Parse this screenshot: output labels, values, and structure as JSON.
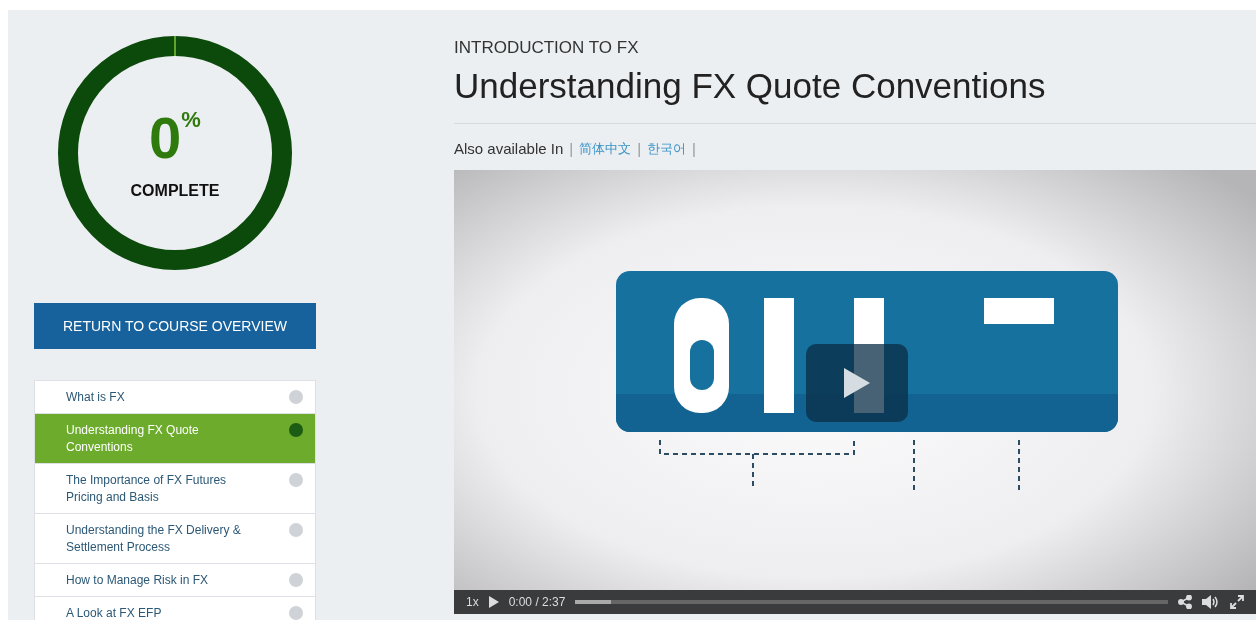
{
  "progress": {
    "value": "0",
    "unit": "%",
    "label": "COMPLETE"
  },
  "return_button": "RETURN TO COURSE OVERVIEW",
  "lessons": [
    {
      "title": "What is FX",
      "selected": false
    },
    {
      "title": "Understanding FX Quote Conventions",
      "selected": true
    },
    {
      "title": "The Importance of FX Futures Pricing and Basis",
      "selected": false
    },
    {
      "title": "Understanding the FX Delivery & Settlement Process",
      "selected": false
    },
    {
      "title": "How to Manage Risk in FX",
      "selected": false
    },
    {
      "title": "A Look at FX EFP",
      "selected": false
    }
  ],
  "course": "INTRODUCTION TO FX",
  "title": "Understanding FX Quote Conventions",
  "languages": {
    "label": "Also available In",
    "separator": "|",
    "links": [
      "简体中文",
      "한국어"
    ]
  },
  "video": {
    "speed": "1x",
    "time": "0:00 / 2:37",
    "progress": {
      "level": 0.06
    }
  }
}
